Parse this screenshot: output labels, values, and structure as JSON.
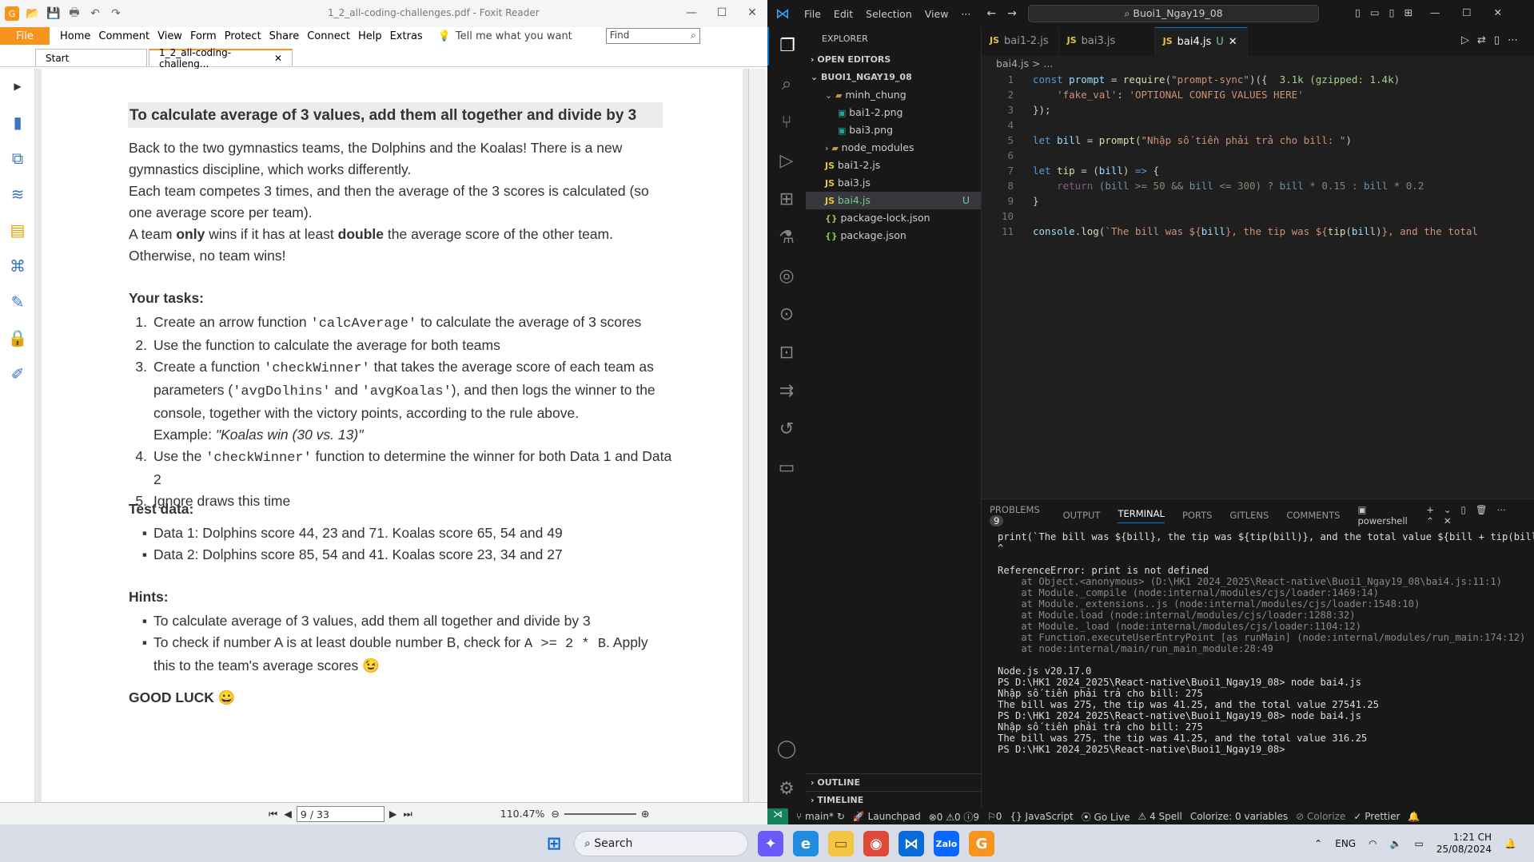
{
  "foxit": {
    "title": "1_2_all-coding-challenges.pdf - Foxit Reader",
    "file": "File",
    "menu": [
      "Home",
      "Comment",
      "View",
      "Form",
      "Protect",
      "Share",
      "Connect",
      "Help",
      "Extras"
    ],
    "tell": "Tell me what you want",
    "find": "Find",
    "tabs": [
      "Start",
      "1_2_all-coding-challeng..."
    ],
    "page": "9 / 33",
    "zoom": "110.47%",
    "doc": {
      "h1": "To calculate average of 3 values, add them all together and divide by 3",
      "p1": "Back to the two gymnastics teams, the Dolphins and the Koalas! There is a new gymnastics discipline, which works differently.",
      "p2": "Each team competes 3 times, and then the average of the 3 scores is calculated (so one average score per team).",
      "p3a": "A team ",
      "p3b": "only",
      "p3c": " wins if it has at least ",
      "p3d": "double",
      "p3e": " the average score of the other team. Otherwise, no team wins!",
      "tasks_h": "Your tasks:",
      "t1a": "Create an arrow function ",
      "t1b": "'calcAverage'",
      "t1c": " to calculate the average of 3 scores",
      "t2": "Use the function to calculate the average for both teams",
      "t3a": "Create a function ",
      "t3b": "'checkWinner'",
      "t3c": " that takes the average score of each team as parameters (",
      "t3d": "'avgDolhins'",
      "t3e": " and ",
      "t3f": "'avgKoalas'",
      "t3g": "), and then logs the winner to the console, together with the victory points, according to the rule above.",
      "t3ex": "Example: ",
      "t3exi": "\"Koalas win (30 vs. 13)\"",
      "t4a": "Use the ",
      "t4b": "'checkWinner'",
      "t4c": " function to determine the winner for both Data 1 and Data 2",
      "t5": "Ignore draws this time",
      "test_h": "Test data:",
      "d1": "Data 1: Dolphins score 44, 23 and 71. Koalas score 65, 54 and 49",
      "d2": "Data 2: Dolphins score 85, 54 and 41. Koalas score 23, 34 and 27",
      "hints_h": "Hints:",
      "h2a": "To check if number A is at least double number B, check for ",
      "h2b": "A >= 2 * B",
      "h2c": ". Apply this to the team's average scores 😉",
      "luck": "GOOD LUCK 😀"
    }
  },
  "vscode": {
    "menu": [
      "File",
      "Edit",
      "Selection",
      "View",
      "···"
    ],
    "search": "Buoi1_Ngay19_08",
    "explorer": "EXPLORER",
    "open_editors": "OPEN EDITORS",
    "root": "BUOI1_NGAY19_08",
    "tree": [
      {
        "name": "minh_chung",
        "type": "folder",
        "depth": 1
      },
      {
        "name": "bai1-2.png",
        "type": "png",
        "depth": 2
      },
      {
        "name": "bai3.png",
        "type": "png",
        "depth": 2
      },
      {
        "name": "node_modules",
        "type": "folder",
        "depth": 1
      },
      {
        "name": "bai1-2.js",
        "type": "js",
        "depth": 1
      },
      {
        "name": "bai3.js",
        "type": "js",
        "depth": 1
      },
      {
        "name": "bai4.js",
        "type": "js",
        "depth": 1,
        "badge": "U"
      },
      {
        "name": "package-lock.json",
        "type": "json",
        "depth": 1
      },
      {
        "name": "package.json",
        "type": "json",
        "depth": 1
      }
    ],
    "outline": "OUTLINE",
    "timeline": "TIMELINE",
    "tabs": [
      "bai1-2.js",
      "bai3.js",
      "bai4.js"
    ],
    "tab_badge": "U",
    "breadcrumb": "bai4.js > ...",
    "code_lines": [
      "1",
      "2",
      "3",
      "4",
      "5",
      "6",
      "7",
      "8",
      "9",
      "10",
      "11"
    ],
    "import_size": "3.1k (gzipped: 1.4k)",
    "terminal_tabs": [
      "PROBLEMS",
      "OUTPUT",
      "TERMINAL",
      "PORTS",
      "GITLENS",
      "COMMENTS"
    ],
    "problems_count": "9",
    "shell": "powershell",
    "terminal": [
      "print(`The bill was ${bill}, the tip was ${tip(bill)}, and the total value ${bill + tip(bill)}`)",
      "^",
      "",
      "ReferenceError: print is not defined",
      "    at Object.<anonymous> (D:\\HK1 2024_2025\\React-native\\Buoi1_Ngay19_08\\bai4.js:11:1)",
      "    at Module._compile (node:internal/modules/cjs/loader:1469:14)",
      "    at Module._extensions..js (node:internal/modules/cjs/loader:1548:10)",
      "    at Module.load (node:internal/modules/cjs/loader:1288:32)",
      "    at Module._load (node:internal/modules/cjs/loader:1104:12)",
      "    at Function.executeUserEntryPoint [as runMain] (node:internal/modules/run_main:174:12)",
      "    at node:internal/main/run_main_module:28:49",
      "",
      "Node.js v20.17.0",
      "PS D:\\HK1 2024_2025\\React-native\\Buoi1_Ngay19_08> node bai4.js",
      "Nhập số tiền phải trả cho bill: 275",
      "The bill was 275, the tip was 41.25, and the total value 27541.25",
      "PS D:\\HK1 2024_2025\\React-native\\Buoi1_Ngay19_08> node bai4.js",
      "Nhập số tiền phải trả cho bill: 275",
      "The bill was 275, the tip was 41.25, and the total value 316.25",
      "PS D:\\HK1 2024_2025\\React-native\\Buoi1_Ngay19_08> "
    ],
    "status": [
      "main*",
      "Launchpad",
      "⊗0 ⚠0 ⓘ9",
      "⚐0",
      "JavaScript",
      "Go Live",
      "⚠ 4 Spell",
      "Colorize: 0 variables",
      "Colorize",
      "✓ Prettier"
    ]
  },
  "taskbar": {
    "search": "Search",
    "lang": "ENG",
    "time": "1:21 CH",
    "date": "25/08/2024"
  },
  "colors": {
    "foxit_orange": "#f7941d",
    "vs_blue": "#0078d4",
    "status_green": "#16825d"
  }
}
